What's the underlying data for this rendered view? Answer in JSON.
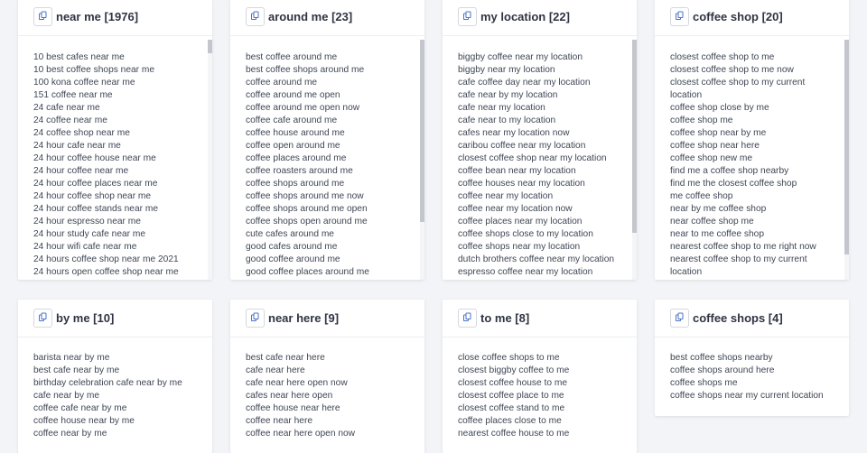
{
  "cards": [
    {
      "title": "near me [1976]",
      "keywords": [
        "10 best cafes near me",
        "10 best coffee shops near me",
        "100 kona coffee near me",
        "151 coffee near me",
        "24 cafe near me",
        "24 coffee near me",
        "24 coffee shop near me",
        "24 hour cafe near me",
        "24 hour coffee house near me",
        "24 hour coffee near me",
        "24 hour coffee places near me",
        "24 hour coffee shop near me",
        "24 hour coffee stands near me",
        "24 hour espresso near me",
        "24 hour study cafe near me",
        "24 hour wifi cafe near me",
        "24 hours coffee shop near me 2021",
        "24 hours open coffee shop near me"
      ]
    },
    {
      "title": "around me [23]",
      "keywords": [
        "best coffee around me",
        "best coffee shops around me",
        "coffee around me",
        "coffee around me open",
        "coffee around me open now",
        "coffee cafe around me",
        "coffee house around me",
        "coffee open around me",
        "coffee places around me",
        "coffee roasters around me",
        "coffee shops around me",
        "coffee shops around me now",
        "coffee shops around me open",
        "coffee shops open around me",
        "cute cafes around me",
        "good cafes around me",
        "good coffee around me",
        "good coffee places around me"
      ]
    },
    {
      "title": "my location [22]",
      "keywords": [
        "biggby coffee near my location",
        "biggby near my location",
        "cafe coffee day near my location",
        "cafe near by my location",
        "cafe near my location",
        "cafe near to my location",
        "cafes near my location now",
        "caribou coffee near my location",
        "closest coffee shop near my location",
        "coffee bean near my location",
        "coffee houses near my location",
        "coffee near my location",
        "coffee near my location now",
        "coffee places near my location",
        "coffee shops close to my location",
        "coffee shops near my location",
        "dutch brothers coffee near my location",
        "espresso coffee near my location"
      ]
    },
    {
      "title": "coffee shop [20]",
      "keywords": [
        "closest coffee shop to me",
        "closest coffee shop to me now",
        "closest coffee shop to my current location",
        "coffee shop close by me",
        "coffee shop me",
        "coffee shop near by me",
        "coffee shop near here",
        "coffee shop new me",
        "find me a coffee shop nearby",
        "find me the closest coffee shop",
        "me coffee shop",
        "near by me coffee shop",
        "near coffee shop me",
        "near to me coffee shop",
        "nearest coffee shop to me right now",
        "nearest coffee shop to my current location"
      ]
    },
    {
      "title": "by me [10]",
      "keywords": [
        "barista near by me",
        "best cafe near by me",
        "birthday celebration cafe near by me",
        "cafe near by me",
        "coffee cafe near by me",
        "coffee house near by me",
        "coffee near by me"
      ]
    },
    {
      "title": "near here [9]",
      "keywords": [
        "best cafe near here",
        "cafe near here",
        "cafe near here open now",
        "cafes near here open",
        "coffee house near here",
        "coffee near here",
        "coffee near here open now"
      ]
    },
    {
      "title": "to me [8]",
      "keywords": [
        "close coffee shops to me",
        "closest biggby coffee to me",
        "closest coffee house to me",
        "closest coffee place to me",
        "closest coffee stand to me",
        "coffee places close to me",
        "nearest coffee house to me"
      ]
    },
    {
      "title": "coffee shops [4]",
      "keywords": [
        "best coffee shops nearby",
        "coffee shops around here",
        "coffee shops me",
        "coffee shops near my current location"
      ]
    }
  ]
}
